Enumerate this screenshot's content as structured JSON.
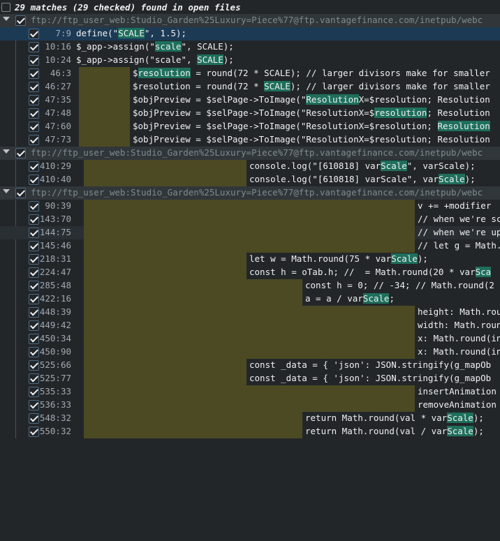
{
  "header": {
    "title": "29 matches (29 checked) found in open files"
  },
  "files": [
    {
      "path": "ftp://ftp_user_web:Studio_Garden%25Luxury=Piece%77@ftp.vantagefinance.com/inetpub/webc",
      "matches": [
        {
          "line": "7:9",
          "pre": "define(\"",
          "hit": "SCALE",
          "post": "\", 1.5);"
        },
        {
          "line": "10:16",
          "pre": "$_app->assign(\"",
          "hit": "scale",
          "post": "\", SCALE);"
        },
        {
          "line": "10:24",
          "pre": "$_app->assign(\"scale\", ",
          "hit": "SCALE",
          "post": ");"
        },
        {
          "line": "46:3",
          "pre": "$",
          "hit": "resolution",
          "post": " = round(72 * SCALE); // larger divisors make for smaller"
        },
        {
          "line": "46:27",
          "pre": "$resolution = round(72 * ",
          "hit": "SCALE",
          "post": "); // larger divisors make for smaller"
        },
        {
          "line": "47:35",
          "pre": "$objPreview = $selPage->ToImage(\"",
          "hit": "Resolution",
          "post": "X=$resolution; Resolution"
        },
        {
          "line": "47:48",
          "pre": "$objPreview = $selPage->ToImage(\"ResolutionX=$",
          "hit": "resolution",
          "post": "; Resolution"
        },
        {
          "line": "47:60",
          "pre": "$objPreview = $selPage->ToImage(\"ResolutionX=$resolution; ",
          "hit": "Resolution",
          "post": ""
        },
        {
          "line": "47:73",
          "pre": "$objPreview = $selPage->ToImage(\"ResolutionX=$resolution; Resolution",
          "hit": "",
          "post": ""
        }
      ]
    },
    {
      "path": "ftp://ftp_user_web:Studio_Garden%25Luxury=Piece%77@ftp.vantagefinance.com/inetpub/webc",
      "matches": [
        {
          "line": "410:29",
          "pre": "console.log(\"[610818] var",
          "hit": "Scale",
          "post": "\", varScale);"
        },
        {
          "line": "410:40",
          "pre": "console.log(\"[610818] varScale\", var",
          "hit": "Scale",
          "post": ");"
        }
      ]
    },
    {
      "path": "ftp://ftp_user_web:Studio_Garden%25Luxury=Piece%77@ftp.vantagefinance.com/inetpub/webc",
      "matches": [
        {
          "line": "90:39",
          "pre": "v += +modifier ",
          "hit": "",
          "post": ""
        },
        {
          "line": "143:70",
          "pre": "// when we're sc",
          "hit": "",
          "post": ""
        },
        {
          "line": "144:75",
          "pre": "// when we're up",
          "hit": "",
          "post": ""
        },
        {
          "line": "145:46",
          "pre": "// let g = Math.",
          "hit": "",
          "post": ""
        },
        {
          "line": "218:31",
          "pre": "let w = Math.round(75 * var",
          "hit": "Scale",
          "post": ");"
        },
        {
          "line": "224:47",
          "pre": "const h = oTab.h; //  = Math.round(20 * var",
          "hit": "Sca",
          "post": ""
        },
        {
          "line": "285:48",
          "pre": "const h = 0; // -34; // Math.round(2",
          "hit": "",
          "post": ""
        },
        {
          "line": "422:16",
          "pre": "a = a / var",
          "hit": "Scale",
          "post": ";"
        },
        {
          "line": "448:39",
          "pre": "height: Math.roun",
          "hit": "",
          "post": ""
        },
        {
          "line": "449:42",
          "pre": "width: Math.roun",
          "hit": "",
          "post": ""
        },
        {
          "line": "450:34",
          "pre": "x: Math.round(in",
          "hit": "",
          "post": ""
        },
        {
          "line": "450:90",
          "pre": "x: Math.round(in",
          "hit": "",
          "post": ""
        },
        {
          "line": "525:66",
          "pre": "const _data = { 'json': JSON.stringify(g_mapOb",
          "hit": "",
          "post": ""
        },
        {
          "line": "525:77",
          "pre": "const _data = { 'json': JSON.stringify(g_mapOb",
          "hit": "",
          "post": ""
        },
        {
          "line": "535:33",
          "pre": "insertAnimation",
          "hit": "",
          "post": ""
        },
        {
          "line": "536:33",
          "pre": "removeAnimation",
          "hit": "",
          "post": ""
        },
        {
          "line": "548:32",
          "pre": "return Math.round(val * var",
          "hit": "Scale",
          "post": ");"
        },
        {
          "line": "550:32",
          "pre": "return Math.round(val / var",
          "hit": "Scale",
          "post": ");"
        }
      ]
    }
  ]
}
